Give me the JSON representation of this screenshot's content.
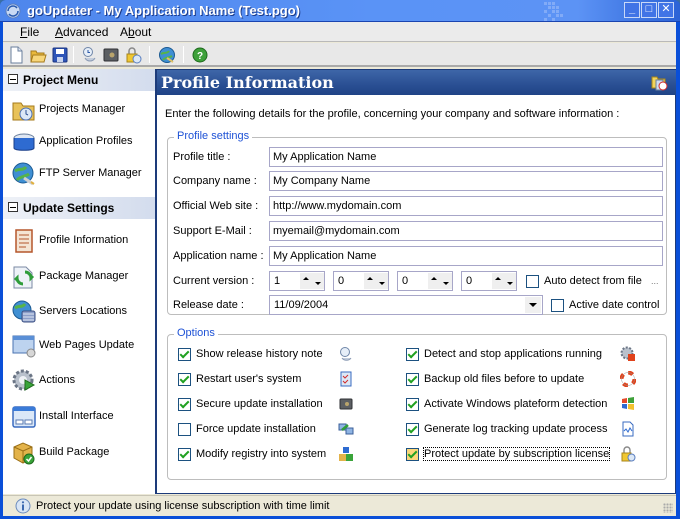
{
  "window": {
    "title": "goUpdater - My Application Name (Test.pgo)",
    "controls": {
      "minimize": "_",
      "maximize": "□",
      "close": "✕"
    }
  },
  "menu": [
    {
      "label": "File",
      "accel": "F",
      "rest": "ile"
    },
    {
      "label": "Advanced",
      "accel": "A",
      "rest": "dvanced"
    },
    {
      "label": "About",
      "pre": "A",
      "accel": "b",
      "rest": "out"
    }
  ],
  "toolbar": {
    "buttons": [
      "new-file-icon",
      "open-folder-icon",
      "save-icon",
      "release-history-icon",
      "safe-icon",
      "lock-clock-icon",
      "ftp-globe-icon",
      "help-icon"
    ]
  },
  "sidebar": {
    "sections": [
      {
        "title": "Project Menu",
        "items": [
          {
            "label": "Projects Manager",
            "icon": "folder-clock-icon"
          },
          {
            "label": "Application Profiles",
            "icon": "profiles-box-icon"
          },
          {
            "label": "FTP Server Manager",
            "icon": "globe-plug-icon"
          }
        ]
      },
      {
        "title": "Update Settings",
        "items": [
          {
            "label": "Profile Information",
            "icon": "document-lines-icon"
          },
          {
            "label": "Package Manager",
            "icon": "package-arrows-icon"
          },
          {
            "label": "Servers Locations",
            "icon": "globe-server-icon"
          },
          {
            "label": "Web Pages Update",
            "icon": "web-page-icon"
          },
          {
            "label": "Actions",
            "icon": "gear-play-icon"
          },
          {
            "label": "Install Interface",
            "icon": "window-icon"
          },
          {
            "label": "Build Package",
            "icon": "box-check-icon"
          }
        ]
      }
    ]
  },
  "main": {
    "title": "Profile Information",
    "header_icon": "folder-clock-icon",
    "intro": "Enter the following details for the profile, concerning your company and software information :",
    "profile_settings": {
      "legend": "Profile settings",
      "fields": [
        {
          "label": "Profile title :",
          "value": "My Application Name"
        },
        {
          "label": "Company name :",
          "value": "My Company Name"
        },
        {
          "label": "Official Web site :",
          "value": "http://www.mydomain.com"
        },
        {
          "label": "Support E-Mail :",
          "value": "myemail@mydomain.com"
        },
        {
          "label": "Application name :",
          "value": "My Application Name"
        }
      ],
      "version": {
        "label": "Current version :",
        "parts": [
          "1",
          "0",
          "0",
          "0"
        ],
        "auto_detect_label": "Auto detect from file",
        "auto_detect_checked": false,
        "browse_label": "..."
      },
      "release": {
        "label": "Release date :",
        "value": "11/09/2004",
        "active_date_label": "Active date control",
        "active_date_checked": false
      }
    },
    "options": {
      "legend": "Options",
      "left": [
        {
          "label": "Show release history note",
          "checked": true,
          "icon": "release-history-icon"
        },
        {
          "label": "Restart user's system",
          "checked": true,
          "icon": "checklist-icon"
        },
        {
          "label": "Secure update installation",
          "checked": true,
          "icon": "safe-icon"
        },
        {
          "label": "Force update installation",
          "checked": false,
          "icon": "computers-arrow-icon"
        },
        {
          "label": "Modify registry into system",
          "checked": true,
          "icon": "registry-cubes-icon"
        }
      ],
      "right": [
        {
          "label": "Detect and stop applications running",
          "checked": true,
          "icon": "gear-stop-icon"
        },
        {
          "label": "Backup old files before to update",
          "checked": true,
          "icon": "lifebuoy-icon"
        },
        {
          "label": "Activate Windows plateform detection",
          "checked": true,
          "icon": "windows-logo-icon"
        },
        {
          "label": "Generate log tracking update process",
          "checked": true,
          "icon": "log-file-icon"
        },
        {
          "label": "Protect update by subscription license",
          "checked": true,
          "icon": "lock-clock-icon",
          "focused": true
        }
      ]
    }
  },
  "status": {
    "text": "Protect your update using license subscription with time limit"
  }
}
